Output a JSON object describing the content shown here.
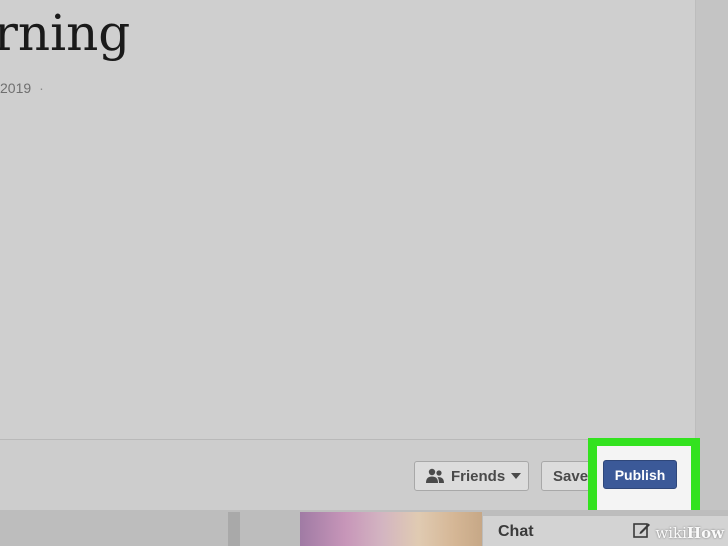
{
  "editor": {
    "title": "rning",
    "meta_date": "2019",
    "meta_separator": "·"
  },
  "footer": {
    "privacy_label": "Friends",
    "save_label": "Save",
    "publish_label": "Publish"
  },
  "chat": {
    "label": "Chat"
  },
  "watermark": {
    "text_wiki": "wiki",
    "text_how": "How"
  },
  "colors": {
    "publish_bg": "#3b5998",
    "highlight": "#33e21f"
  },
  "icons": {
    "privacy": "friends-icon",
    "dropdown": "caret-down-icon",
    "compose": "compose-icon"
  }
}
